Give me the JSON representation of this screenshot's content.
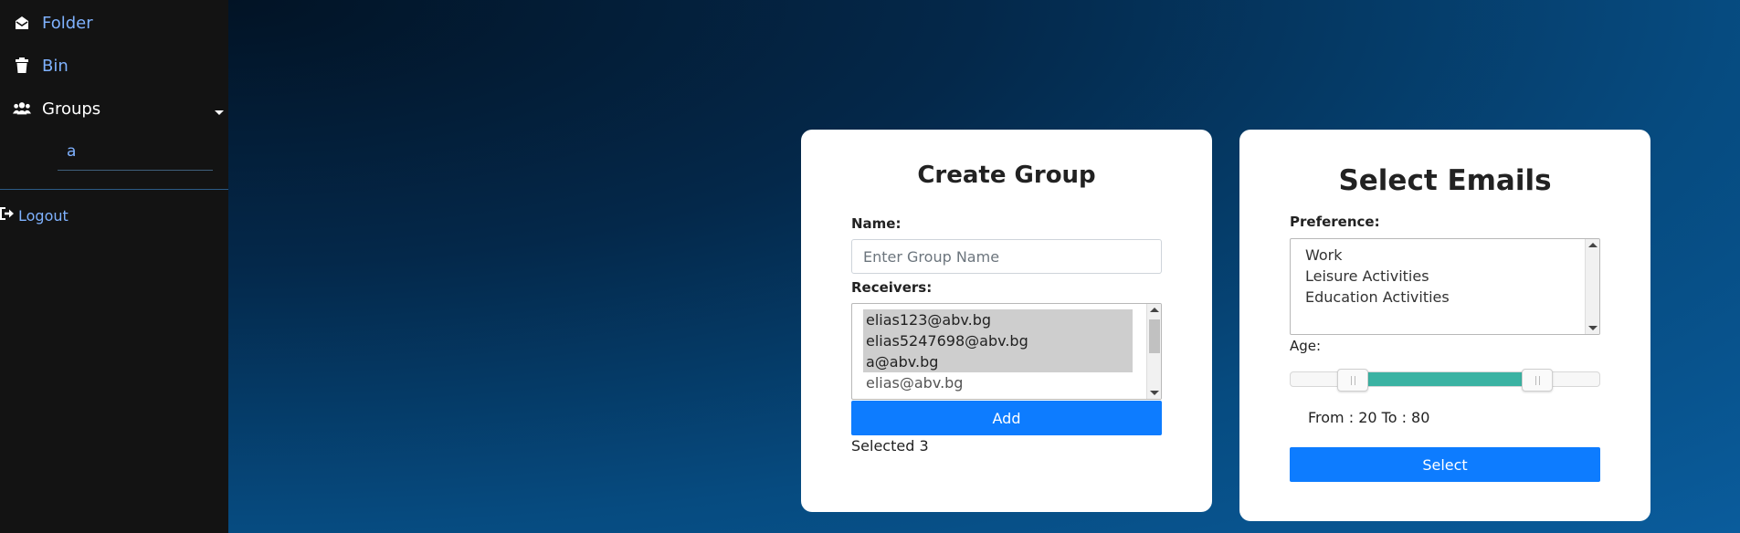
{
  "sidebar": {
    "folder_label": "Folder",
    "bin_label": "Bin",
    "groups_label": "Groups",
    "group_items": [
      "a"
    ],
    "logout_label": "Logout"
  },
  "create_group": {
    "title": "Create Group",
    "name_label": "Name:",
    "name_placeholder": "Enter Group Name",
    "name_value": "",
    "receivers_label": "Receivers:",
    "receivers": [
      {
        "email": "elias123@abv.bg",
        "selected": true
      },
      {
        "email": "elias5247698@abv.bg",
        "selected": true
      },
      {
        "email": "a@abv.bg",
        "selected": true
      },
      {
        "email": "elias@abv.bg",
        "selected": false
      }
    ],
    "add_button": "Add",
    "selected_text": "Selected 3"
  },
  "select_emails": {
    "title": "Select Emails",
    "preference_label": "Preference:",
    "preferences": [
      "Work",
      "Leisure Activities",
      "Education Activities"
    ],
    "age_label": "Age:",
    "age_min": 0,
    "age_max": 100,
    "age_from": 20,
    "age_to": 80,
    "range_text": "From : 20 To : 80",
    "select_button": "Select"
  },
  "colors": {
    "accent": "#0d7cff",
    "slider_range": "#3bb3a3",
    "link": "#7fb2ff",
    "sidebar_bg": "#131313"
  },
  "icons": {
    "folder": "envelope-open-icon",
    "bin": "trash-icon",
    "groups": "users-icon",
    "logout": "sign-out-icon"
  }
}
